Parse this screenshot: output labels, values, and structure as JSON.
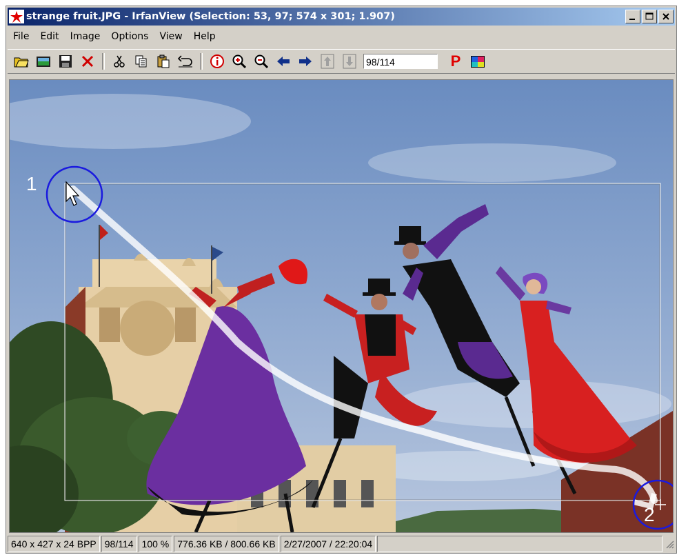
{
  "window": {
    "title": "strange fruit.JPG - IrfanView (Selection: 53, 97; 574 x 301; 1.907)",
    "buttons": {
      "minimize": "_",
      "maximize": "□",
      "close": "×"
    }
  },
  "menu": {
    "items": [
      {
        "label": "File"
      },
      {
        "label": "Edit"
      },
      {
        "label": "Image"
      },
      {
        "label": "Options"
      },
      {
        "label": "View"
      },
      {
        "label": "Help"
      }
    ]
  },
  "toolbar": {
    "page_value": "98/114",
    "p_label": "P"
  },
  "annotations": {
    "point1": "1",
    "point2": "2"
  },
  "statusbar": {
    "dimensions": "640 x 427 x 24 BPP",
    "page": "98/114",
    "zoom": "100 %",
    "size": "776.36 KB / 800.66 KB",
    "datetime": "2/27/2007 / 22:20:04"
  },
  "colors": {
    "titlebar_start": "#0a246a",
    "titlebar_end": "#a6caf0",
    "annotation_circle": "#1a1adf",
    "sky": "#7f9cc8"
  }
}
